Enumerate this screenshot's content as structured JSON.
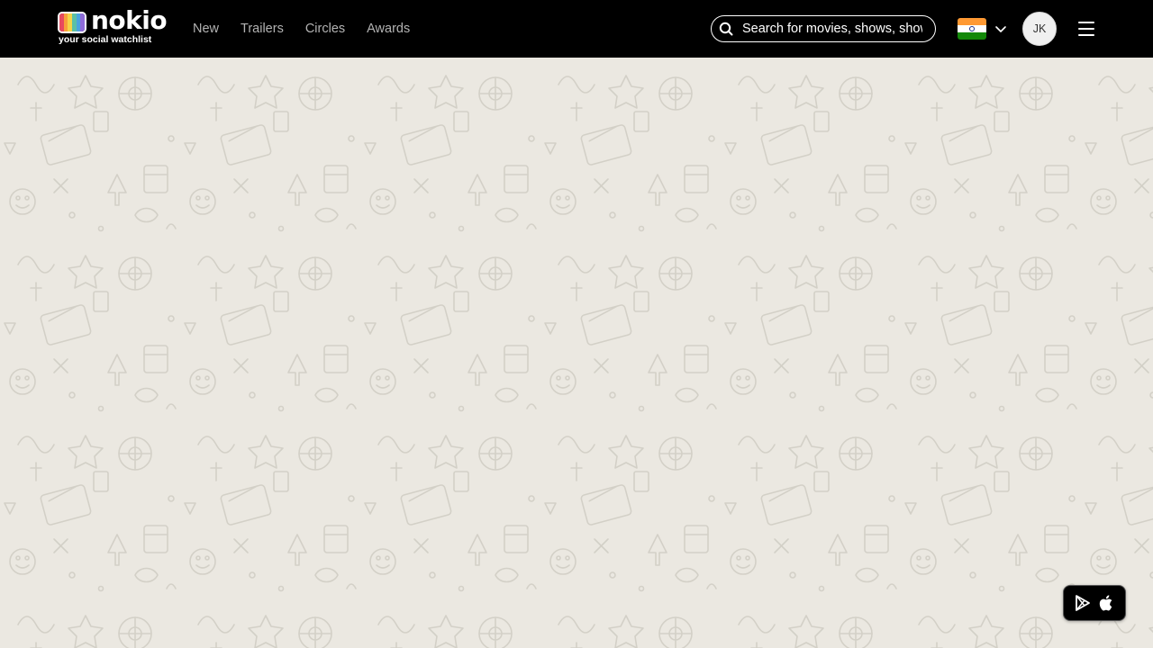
{
  "brand": {
    "name": "nokio",
    "tagline": "your social watchlist",
    "logo_stripe_colors": [
      "#e84a5f",
      "#f8a03a",
      "#f5d547",
      "#5bc0a5",
      "#4aa3df",
      "#8e6bd8"
    ]
  },
  "nav": {
    "items": [
      {
        "label": "New"
      },
      {
        "label": "Trailers"
      },
      {
        "label": "Circles"
      },
      {
        "label": "Awards"
      }
    ]
  },
  "search": {
    "placeholder": "Search for movies, shows, shows",
    "value": ""
  },
  "region": {
    "flag_colors": [
      "#ff9933",
      "#ffffff",
      "#138808"
    ],
    "icon": "india-flag-icon"
  },
  "user": {
    "initials": "JK"
  },
  "colors": {
    "topbar": "#000000",
    "background": "#ebe8e1",
    "pattern": "#d3d0c7"
  },
  "app_download": {
    "icons": [
      "google-play-icon",
      "apple-icon"
    ]
  }
}
